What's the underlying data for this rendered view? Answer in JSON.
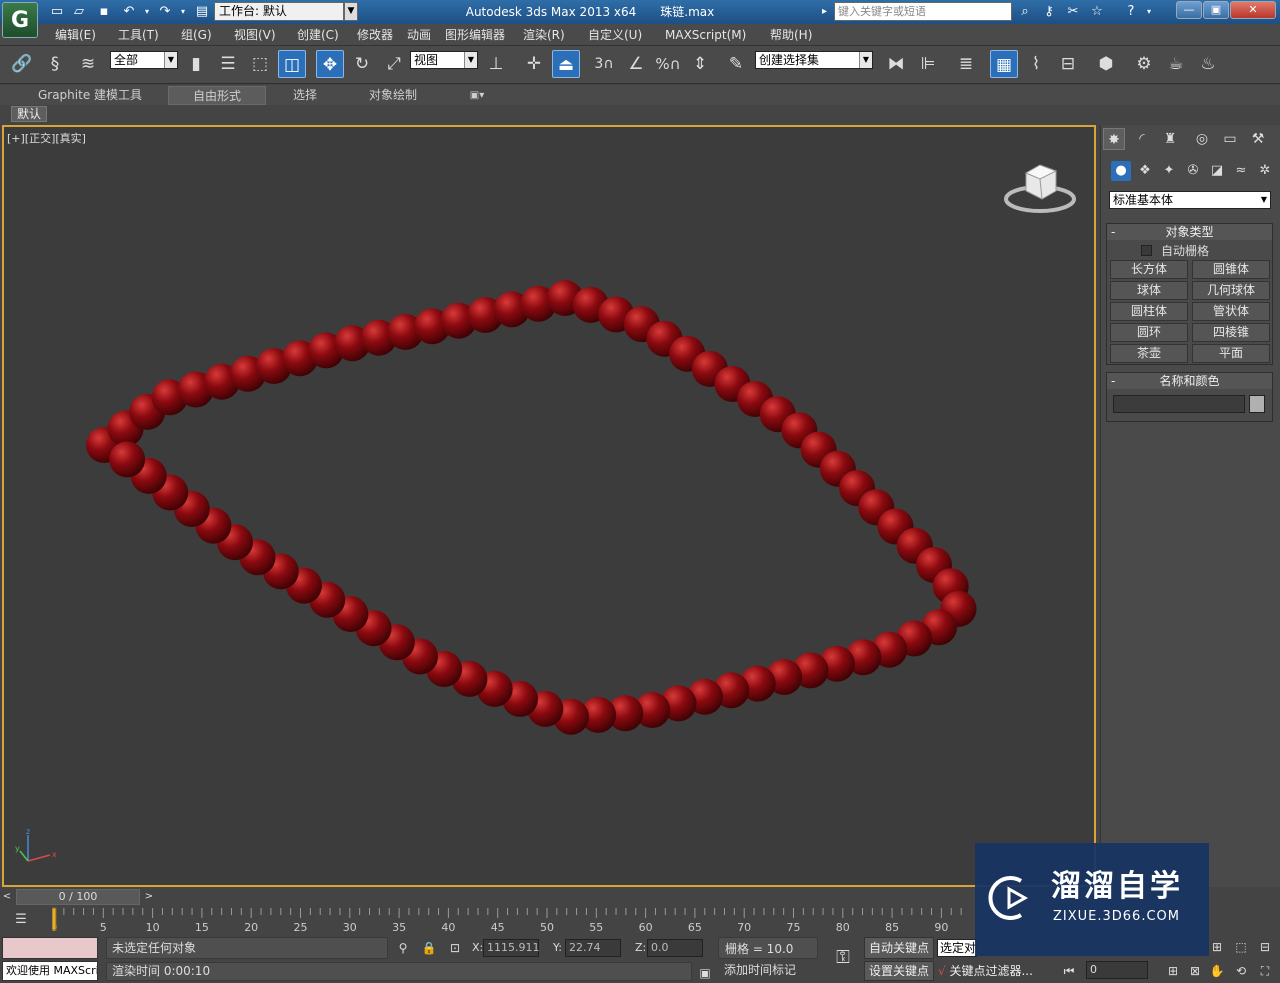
{
  "titlebar": {
    "app_title": "Autodesk 3ds Max  2013 x64",
    "file_name": "珠链.max",
    "workspace_label": "工作台: 默认",
    "search_placeholder": "键入关键字或短语",
    "min_label": "—",
    "max_label": "▣",
    "close_label": "✕"
  },
  "menubar": {
    "items": [
      "编辑(E)",
      "工具(T)",
      "组(G)",
      "视图(V)",
      "创建(C)",
      "修改器",
      "动画",
      "图形编辑器",
      "渲染(R)",
      "自定义(U)",
      "MAXScript(M)",
      "帮助(H)"
    ]
  },
  "toolbar": {
    "selection_filter": "全部",
    "reference_coord": "视图",
    "named_selection": "创建选择集"
  },
  "ribbon": {
    "tabs": [
      "Graphite 建模工具",
      "自由形式",
      "选择",
      "对象绘制"
    ],
    "active_tab": "自由形式",
    "sub_tab": "默认"
  },
  "viewport": {
    "label": "[+][正交][真实]",
    "bead_color": "#8b0a10",
    "border_color": "#d9a43a"
  },
  "command_panel": {
    "category": "标准基本体",
    "object_type_title": "对象类型",
    "autogrid_label": "自动栅格",
    "autogrid_checked": false,
    "object_buttons": [
      "长方体",
      "圆锥体",
      "球体",
      "几何球体",
      "圆柱体",
      "管状体",
      "圆环",
      "四棱锥",
      "茶壶",
      "平面"
    ],
    "name_color_title": "名称和颜色",
    "rollout_toggle": "-"
  },
  "timeline": {
    "frame_display": "0 / 100",
    "prev_label": "<",
    "next_label": ">",
    "tick_labels": [
      "0",
      "5",
      "10",
      "15",
      "20",
      "25",
      "30",
      "35",
      "40",
      "45",
      "50",
      "55",
      "60",
      "65",
      "70",
      "75",
      "80",
      "85",
      "90"
    ]
  },
  "status": {
    "welcome_text": "欢迎使用 MAXScri",
    "selection_status": "未选定任何对象",
    "render_time": "渲染时间  0:00:10",
    "x_label": "X:",
    "x_value": "1115.911",
    "y_label": "Y:",
    "y_value": "22.74",
    "z_label": "Z:",
    "z_value": "0.0",
    "grid_label": "栅格 = 10.0",
    "add_time_tag": "添加时间标记",
    "auto_key": "自动关键点",
    "set_key": "设置关键点",
    "selected_drop": "选定对",
    "key_filters": "关键点过滤器...",
    "current_frame": "0"
  },
  "watermark": {
    "brand_name": "溜溜自学",
    "url": "ZIXUE.3D66.COM"
  }
}
